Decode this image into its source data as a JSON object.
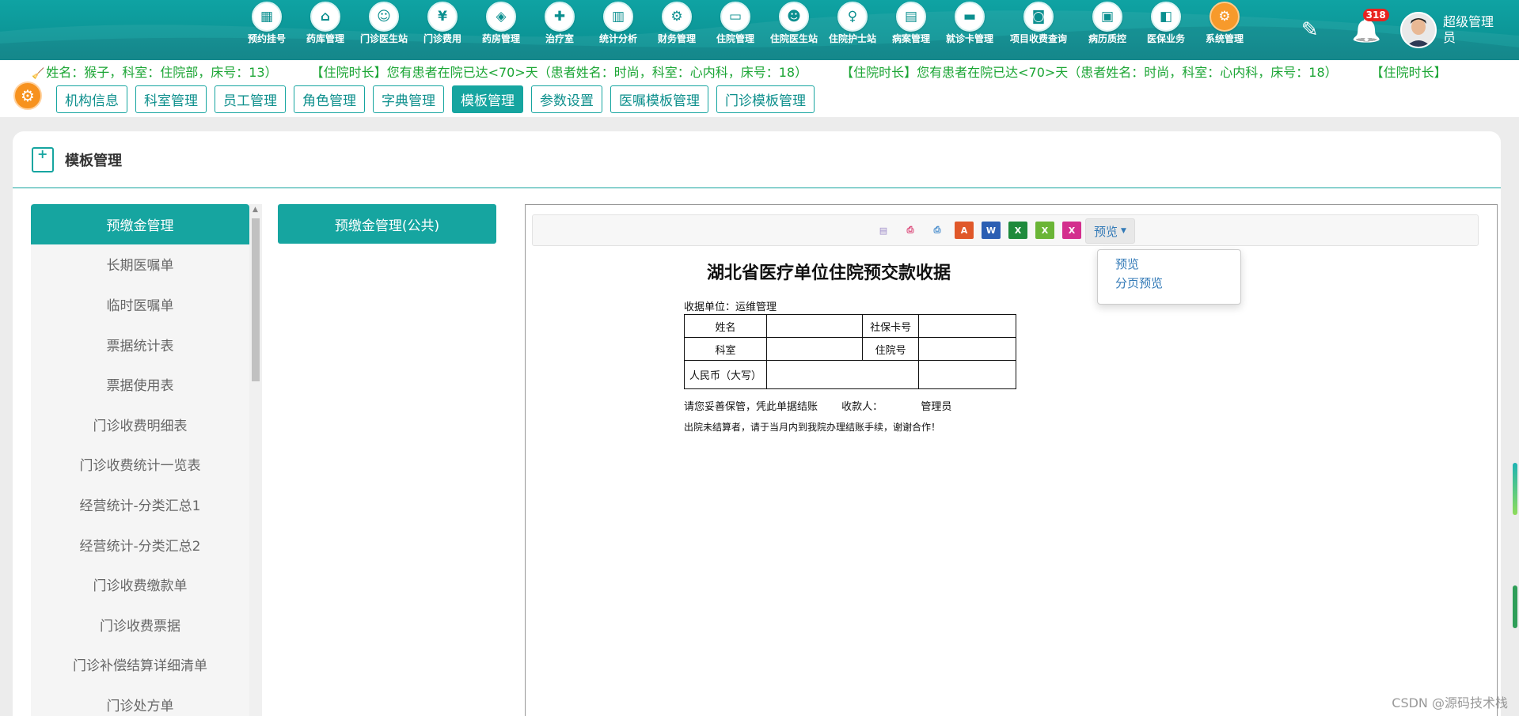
{
  "nav": {
    "items": [
      {
        "label": "预约挂号",
        "icon": "calendar-icon",
        "glyph": "▦"
      },
      {
        "label": "药库管理",
        "icon": "pharmacy-store-icon",
        "glyph": "⌂"
      },
      {
        "label": "门诊医生站",
        "icon": "doctor-icon",
        "glyph": "☺"
      },
      {
        "label": "门诊费用",
        "icon": "yen-icon",
        "glyph": "¥"
      },
      {
        "label": "药房管理",
        "icon": "pill-icon",
        "glyph": "◈"
      },
      {
        "label": "治疗室",
        "icon": "nurse-icon",
        "glyph": "✚"
      },
      {
        "label": "统计分析",
        "icon": "bar-chart-icon",
        "glyph": "▥"
      },
      {
        "label": "财务管理",
        "icon": "finance-gear-icon",
        "glyph": "⚙"
      },
      {
        "label": "住院管理",
        "icon": "bed-icon",
        "glyph": "▭"
      },
      {
        "label": "住院医生站",
        "icon": "inpatient-doctor-icon",
        "glyph": "☻"
      },
      {
        "label": "住院护士站",
        "icon": "inpatient-nurse-icon",
        "glyph": "♀"
      },
      {
        "label": "病案管理",
        "icon": "case-record-icon",
        "glyph": "▤"
      },
      {
        "label": "就诊卡管理",
        "icon": "id-card-icon",
        "glyph": "▬"
      },
      {
        "label": "项目收费查询",
        "icon": "fee-query-icon",
        "glyph": "◙"
      },
      {
        "label": "病历质控",
        "icon": "medical-record-icon",
        "glyph": "▣"
      },
      {
        "label": "医保业务",
        "icon": "insurance-icon",
        "glyph": "◧"
      },
      {
        "label": "系统管理",
        "icon": "system-gear-icon",
        "glyph": "⚙"
      }
    ],
    "edit_icon": "✎",
    "bell_icon": "🔔",
    "badge_count": "318",
    "user_name": "超级管理员"
  },
  "marquee": {
    "messages": [
      "姓名：猴子，科室：住院部，床号：13）",
      "【住院时长】您有患者在院已达<70>天（患者姓名：时尚，科室：心内科，床号：18）",
      "【住院时长】您有患者在院已达<70>天（患者姓名：时尚，科室：心内科，床号：18）",
      "【住院时长】"
    ]
  },
  "subtabs": [
    {
      "label": "机构信息",
      "active": false
    },
    {
      "label": "科室管理",
      "active": false
    },
    {
      "label": "员工管理",
      "active": false
    },
    {
      "label": "角色管理",
      "active": false
    },
    {
      "label": "字典管理",
      "active": false
    },
    {
      "label": "模板管理",
      "active": true
    },
    {
      "label": "参数设置",
      "active": false
    },
    {
      "label": "医嘱模板管理",
      "active": false
    },
    {
      "label": "门诊模板管理",
      "active": false
    }
  ],
  "card": {
    "title": "模板管理"
  },
  "left_list": [
    "预缴金管理",
    "长期医嘱单",
    "临时医嘱单",
    "票据统计表",
    "票据使用表",
    "门诊收费明细表",
    "门诊收费统计一览表",
    "经营统计-分类汇总1",
    "经营统计-分类汇总2",
    "门诊收费缴款单",
    "门诊收费票据",
    "门诊补偿结算详细清单",
    "门诊处方单"
  ],
  "public_button": "预缴金管理(公共)",
  "toolbar": {
    "tools": [
      {
        "name": "design-icon",
        "glyph": "▤",
        "color": "#9e8bc9"
      },
      {
        "name": "print-setup-icon",
        "glyph": "⎙",
        "color": "#d9366c"
      },
      {
        "name": "print-icon",
        "glyph": "⎙",
        "color": "#3a84c9"
      },
      {
        "name": "pdf-icon",
        "glyph": "A",
        "color": "#e0582a"
      },
      {
        "name": "word-icon",
        "glyph": "W",
        "color": "#2b5fb3"
      },
      {
        "name": "excel-icon",
        "glyph": "X",
        "color": "#1e8a3c"
      },
      {
        "name": "excel2-icon",
        "glyph": "X",
        "color": "#6ab536"
      },
      {
        "name": "excel3-icon",
        "glyph": "X",
        "color": "#d32e8d"
      }
    ],
    "preview_label": "预览",
    "menu": [
      "预览",
      "分页预览"
    ]
  },
  "receipt": {
    "title": "湖北省医疗单位住院预交款收据",
    "unit": "收据单位：运维管理",
    "row1": [
      "姓名",
      "",
      "社保卡号",
      ""
    ],
    "row2": [
      "科室",
      "",
      "住院号",
      ""
    ],
    "row3": [
      "人民币（大写）",
      "",
      ""
    ],
    "note1": "请您妥善保管，凭此单据结账",
    "payee_label": "收款人：",
    "payee": "管理员",
    "note2": "出院未结算者，请于当月内到我院办理结账手续，谢谢合作！"
  },
  "watermark": "CSDN @源码技术栈"
}
